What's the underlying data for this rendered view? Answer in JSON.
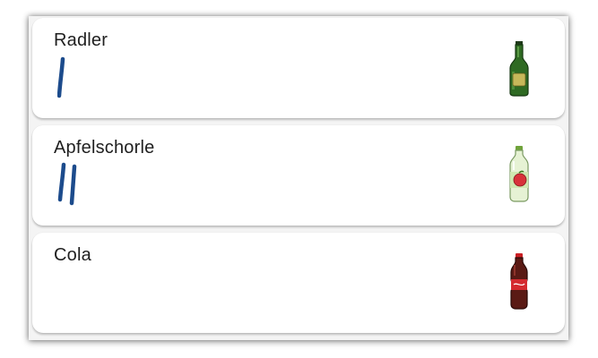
{
  "drinks": [
    {
      "name": "Radler",
      "tally": 1,
      "bottle_icon": "beer-bottle-icon"
    },
    {
      "name": "Apfelschorle",
      "tally": 2,
      "bottle_icon": "apple-spritzer-bottle-icon"
    },
    {
      "name": "Cola",
      "tally": 0,
      "bottle_icon": "cola-bottle-icon"
    }
  ],
  "colors": {
    "tally_ink": "#1c4b8c",
    "card_bg": "#ffffff",
    "frame_bg": "#f4f4f4"
  }
}
